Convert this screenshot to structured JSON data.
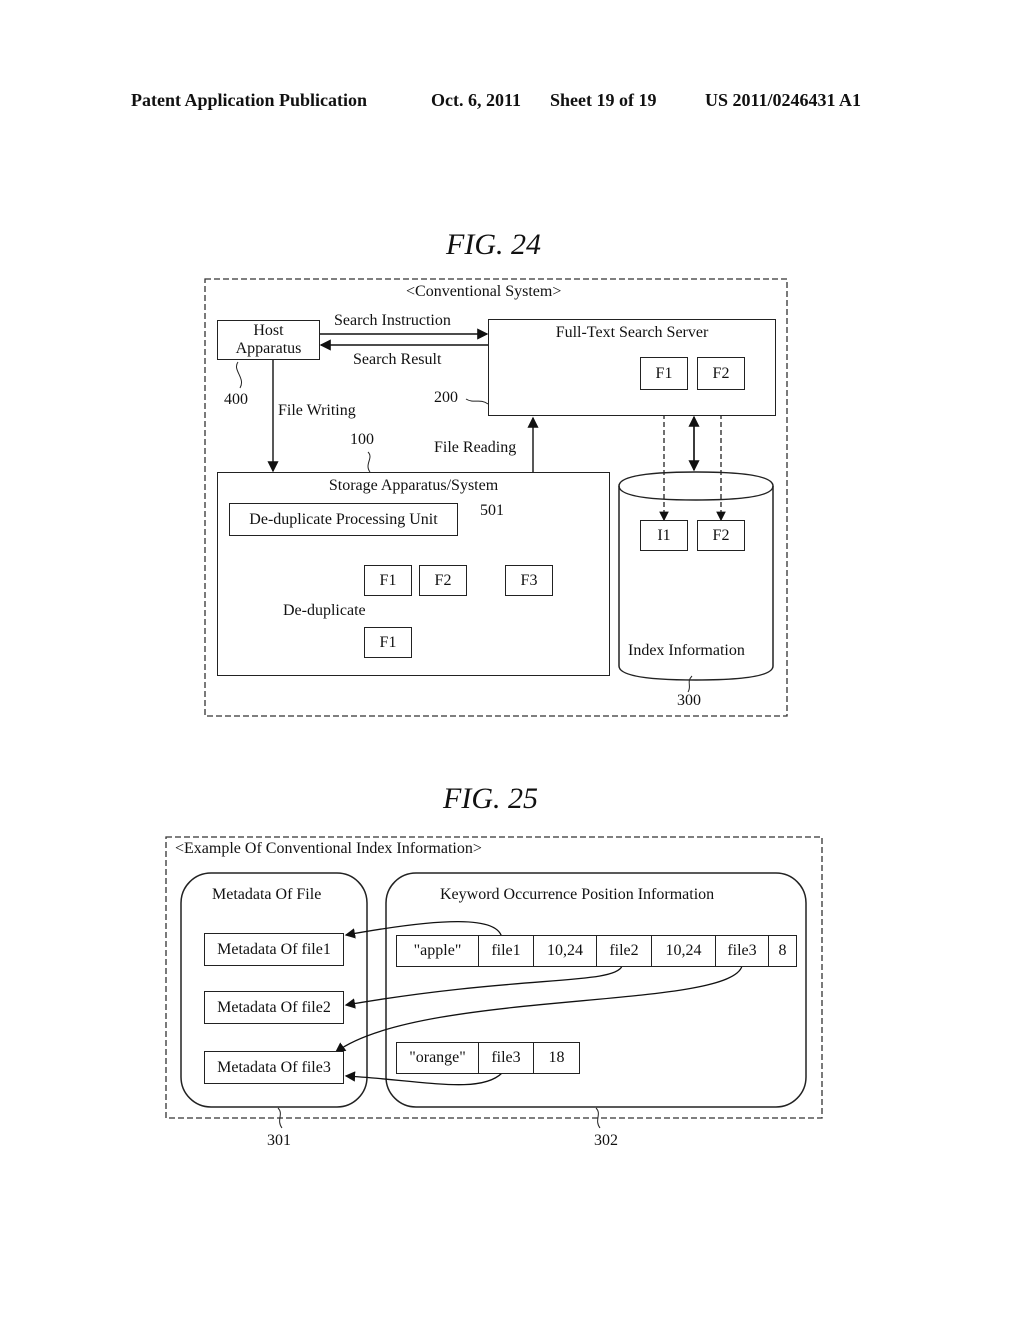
{
  "header": {
    "publication": "Patent Application Publication",
    "date": "Oct. 6, 2011",
    "sheet": "Sheet 19 of 19",
    "number": "US 2011/0246431 A1"
  },
  "fig24": {
    "title": "FIG. 24",
    "frame_label": "<Conventional System>",
    "host": {
      "line1": "Host",
      "line2": "Apparatus",
      "ref": "400"
    },
    "search_instruction": "Search Instruction",
    "search_result": "Search Result",
    "file_writing": "File Writing",
    "file_reading": "File Reading",
    "server": {
      "label": "Full-Text Search Server",
      "ref": "200",
      "files": [
        "F1",
        "F2"
      ]
    },
    "storage": {
      "label": "Storage Apparatus/System",
      "ref": "100",
      "dedup_unit": "De-duplicate Processing Unit",
      "dedup_ref": "501",
      "files": [
        "F1",
        "F2",
        "F3"
      ],
      "dedup_label": "De-duplicate",
      "result_file": "F1"
    },
    "index": {
      "label": "Index Information",
      "ref": "300",
      "files": [
        "I1",
        "F2"
      ]
    }
  },
  "fig25": {
    "title": "FIG. 25",
    "frame_label": "<Example Of Conventional Index Information>",
    "metadata_panel": {
      "title": "Metadata Of File",
      "ref": "301",
      "items": [
        "Metadata Of file1",
        "Metadata Of file2",
        "Metadata Of file3"
      ]
    },
    "keyword_panel": {
      "title": "Keyword Occurrence Position Information",
      "ref": "302",
      "rows": [
        [
          "\"apple\"",
          "file1",
          "10,24",
          "file2",
          "10,24",
          "file3",
          "8"
        ],
        [
          "\"orange\"",
          "file3",
          "18"
        ]
      ]
    }
  }
}
